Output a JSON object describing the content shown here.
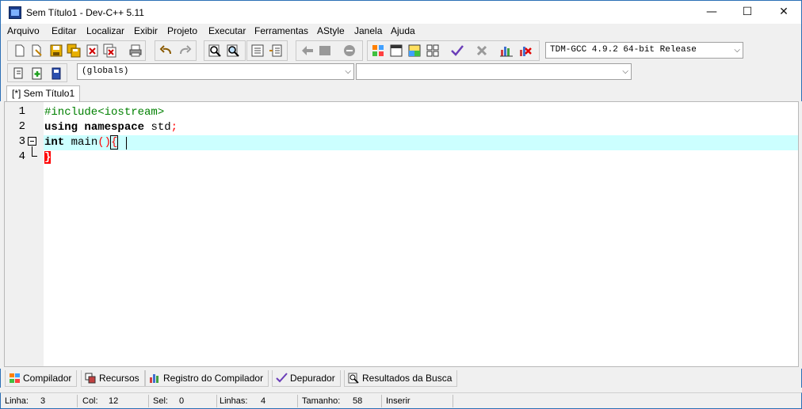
{
  "window": {
    "title": "Sem Título1 - Dev-C++ 5.11",
    "minimize": "—",
    "maximize": "☐",
    "close": "✕"
  },
  "menu": [
    "Arquivo",
    "Editar",
    "Localizar",
    "Exibir",
    "Projeto",
    "Executar",
    "Ferramentas",
    "AStyle",
    "Janela",
    "Ajuda"
  ],
  "toolbar": {
    "compiler_select": "TDM-GCC 4.9.2 64-bit Release",
    "scope_select": "(globals)",
    "member_select": ""
  },
  "editor_tab": "[*] Sem Título1",
  "code": {
    "line_numbers": [
      "1",
      "2",
      "3",
      "4"
    ],
    "line1": "#include<iostream>",
    "line2_kw1": "using",
    "line2_kw2": "namespace",
    "line2_rest": " std",
    "line2_semi": ";",
    "line3_kw": "int",
    "line3_name": " main",
    "line3_paren": "()",
    "line3_brace": "{",
    "line4_brace": "}"
  },
  "bottom_tabs": [
    "Compilador",
    "Recursos",
    "Registro do Compilador",
    "Depurador",
    "Resultados da Busca"
  ],
  "status": {
    "line_label": "Linha:",
    "line_value": "3",
    "col_label": "Col:",
    "col_value": "12",
    "sel_label": "Sel:",
    "sel_value": "0",
    "lines_label": "Linhas:",
    "lines_value": "4",
    "size_label": "Tamanho:",
    "size_value": "58",
    "mode": "Inserir"
  },
  "colors": {
    "accent_border": "#2b6fb5",
    "current_line": "#ccffff",
    "preprocessor": "#008000",
    "brace_match": "#ff0000"
  }
}
